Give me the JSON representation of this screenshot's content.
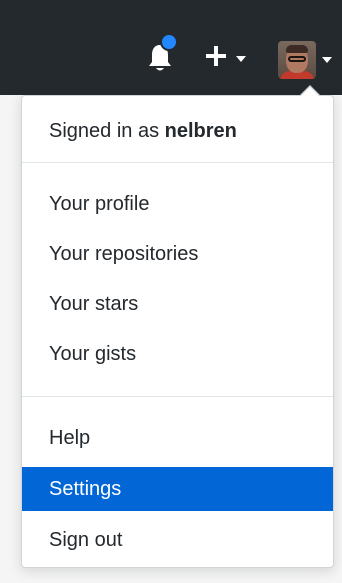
{
  "header": {
    "notifications_icon": "bell-icon",
    "create_icon": "plus-icon",
    "avatar_alt": "user avatar",
    "colors": {
      "background": "#24292e",
      "notification_dot": "#2188ff"
    }
  },
  "menu": {
    "signed_in_prefix": "Signed in as ",
    "username": "nelbren",
    "profile_items": [
      {
        "label": "Your profile"
      },
      {
        "label": "Your repositories"
      },
      {
        "label": "Your stars"
      },
      {
        "label": "Your gists"
      }
    ],
    "help_label": "Help",
    "settings_label": "Settings",
    "signout_label": "Sign out",
    "colors": {
      "active_background": "#0366d6",
      "active_text": "#ffffff",
      "text": "#24292e"
    }
  }
}
